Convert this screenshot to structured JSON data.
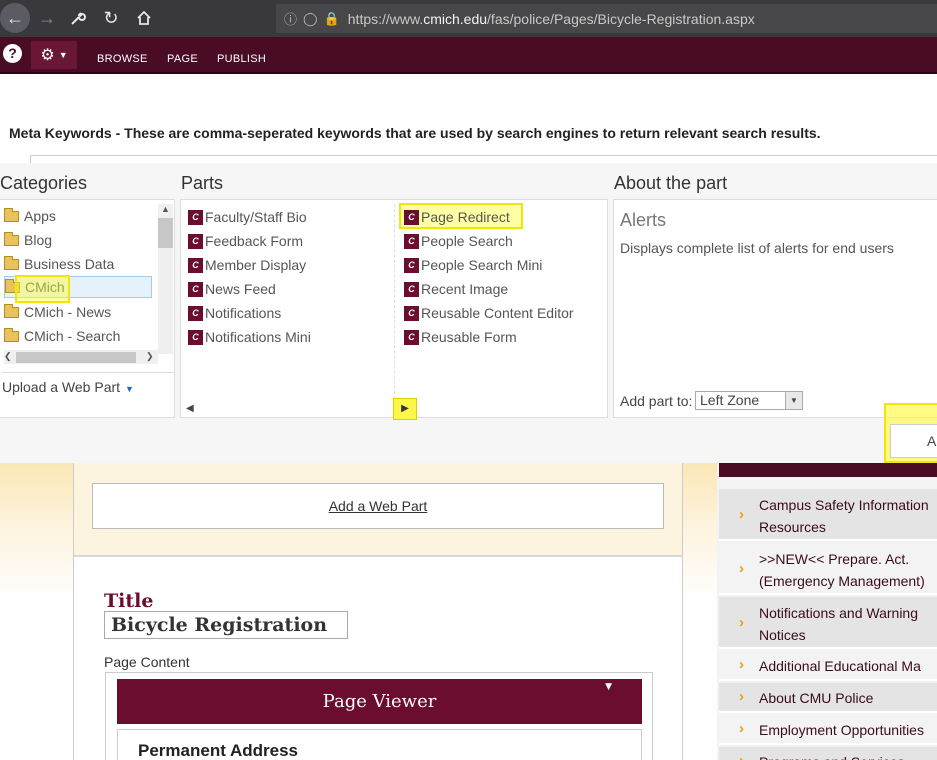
{
  "browser": {
    "url_prefix": "https://www.",
    "url_domain": "cmich.edu",
    "url_path": "/fas/police/Pages/Bicycle-Registration.aspx"
  },
  "ribbon": {
    "tabs": [
      "BROWSE",
      "PAGE",
      "PUBLISH"
    ],
    "help": "?"
  },
  "meta": {
    "text": "Meta Keywords - These are comma-seperated keywords that are used by search engines to return relevant search results."
  },
  "adder": {
    "categories_title": "Categories",
    "parts_title": "Parts",
    "about_title": "About the part",
    "categories": [
      "Apps",
      "Blog",
      "Business Data",
      "CMich",
      "CMich - News",
      "CMich - Search"
    ],
    "selected_category": "CMich",
    "upload_label": "Upload a Web Part",
    "parts_left": [
      "Faculty/Staff Bio",
      "Feedback Form",
      "Member Display",
      "News Feed",
      "Notifications",
      "Notifications Mini"
    ],
    "parts_right": [
      "Page Redirect",
      "People Search",
      "People Search Mini",
      "Recent Image",
      "Reusable Content Editor",
      "Reusable Form"
    ],
    "selected_part": "Page Redirect",
    "about_name": "Alerts",
    "about_desc": "Displays complete list of alerts for end users",
    "add_to_label": "Add part to:",
    "zone_value": "Left Zone",
    "add_button": "Add"
  },
  "page": {
    "add_webpart": "Add a Web Part",
    "title_label": "Title",
    "title_value": "Bicycle Registration",
    "content_label": "Page Content",
    "viewer_title": "Page Viewer",
    "address_heading": "Permanent Address"
  },
  "sidebar": {
    "items": [
      {
        "line1": "Campus Safety Information",
        "line2": "Resources"
      },
      {
        "line1": ">>NEW<< Prepare. Act.",
        "line2": "(Emergency Management)"
      },
      {
        "line1": "Notifications and Warning",
        "line2": "Notices"
      },
      {
        "line1": "Additional Educational Ma",
        "line2": ""
      },
      {
        "line1": "About CMU Police",
        "line2": ""
      },
      {
        "line1": "Employment Opportunities",
        "line2": ""
      },
      {
        "line1": "Programs and Services",
        "line2": ""
      }
    ]
  },
  "colors": {
    "brand_maroon": "#6a0d2e",
    "ribbon": "#4a0b24",
    "highlight_yellow": "#f0e60a",
    "chevron_gold": "#e6a300"
  },
  "icons": [
    "back-arrow-icon",
    "forward-arrow-icon",
    "wrench-icon",
    "reload-icon",
    "home-icon",
    "info-icon",
    "shield-icon",
    "lock-icon",
    "gear-icon",
    "folder-icon",
    "cmu-webpart-icon",
    "chevron-right-icon"
  ]
}
